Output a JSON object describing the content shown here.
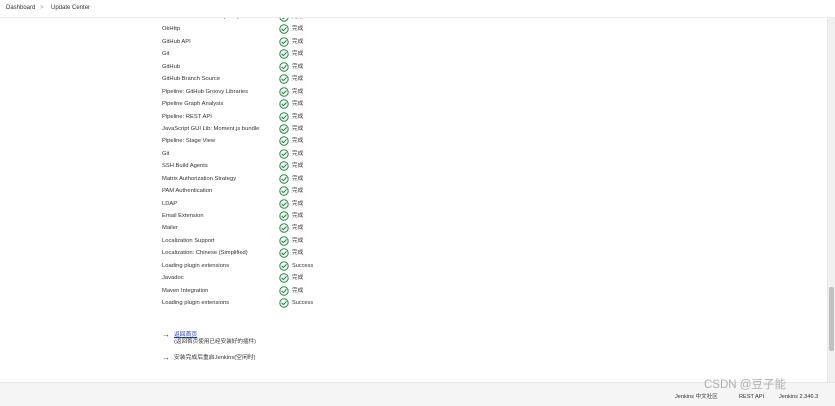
{
  "breadcrumb": {
    "items": [
      "Dashboard",
      "Update Center"
    ],
    "separator": ">"
  },
  "plugins": [
    {
      "name": "Java JSON Web Token (JWT)",
      "status": "完成"
    },
    {
      "name": "OkHttp",
      "status": "完成"
    },
    {
      "name": "GitHub API",
      "status": "完成"
    },
    {
      "name": "Git",
      "status": "完成"
    },
    {
      "name": "GitHub",
      "status": "完成"
    },
    {
      "name": "GitHub Branch Source",
      "status": "完成"
    },
    {
      "name": "Pipeline: GitHub Groovy Libraries",
      "status": "完成"
    },
    {
      "name": "Pipeline Graph Analysis",
      "status": "完成"
    },
    {
      "name": "Pipeline: REST API",
      "status": "完成"
    },
    {
      "name": "JavaScript GUI Lib: Moment.js bundle",
      "status": "完成"
    },
    {
      "name": "Pipeline: Stage View",
      "status": "完成"
    },
    {
      "name": "Git",
      "status": "完成"
    },
    {
      "name": "SSH Build Agents",
      "status": "完成"
    },
    {
      "name": "Matrix Authorization Strategy",
      "status": "完成"
    },
    {
      "name": "PAM Authentication",
      "status": "完成"
    },
    {
      "name": "LDAP",
      "status": "完成"
    },
    {
      "name": "Email Extension",
      "status": "完成"
    },
    {
      "name": "Mailer",
      "status": "完成"
    },
    {
      "name": "Localization Support",
      "status": "完成"
    },
    {
      "name": "Localization: Chinese (Simplified)",
      "status": "完成"
    },
    {
      "name": "Loading plugin extensions",
      "status": "Success"
    },
    {
      "name": "Javadoc",
      "status": "完成"
    },
    {
      "name": "Maven Integration",
      "status": "完成"
    },
    {
      "name": "Loading plugin extensions",
      "status": "Success"
    }
  ],
  "actions": {
    "back_home": {
      "label": "返回首页",
      "description": "(返回首页使用已经安装好的插件)"
    },
    "restart": {
      "label": "安装完成后重启Jenkins(空闲时)"
    }
  },
  "footer": {
    "community": "Jenkins 中文社区",
    "rest_api": "REST API",
    "version": "Jenkins 2.346.3"
  },
  "watermark": "CSDN @豆子能",
  "colors": {
    "check": "#1e8a3c",
    "link": "#1a3ab8"
  }
}
